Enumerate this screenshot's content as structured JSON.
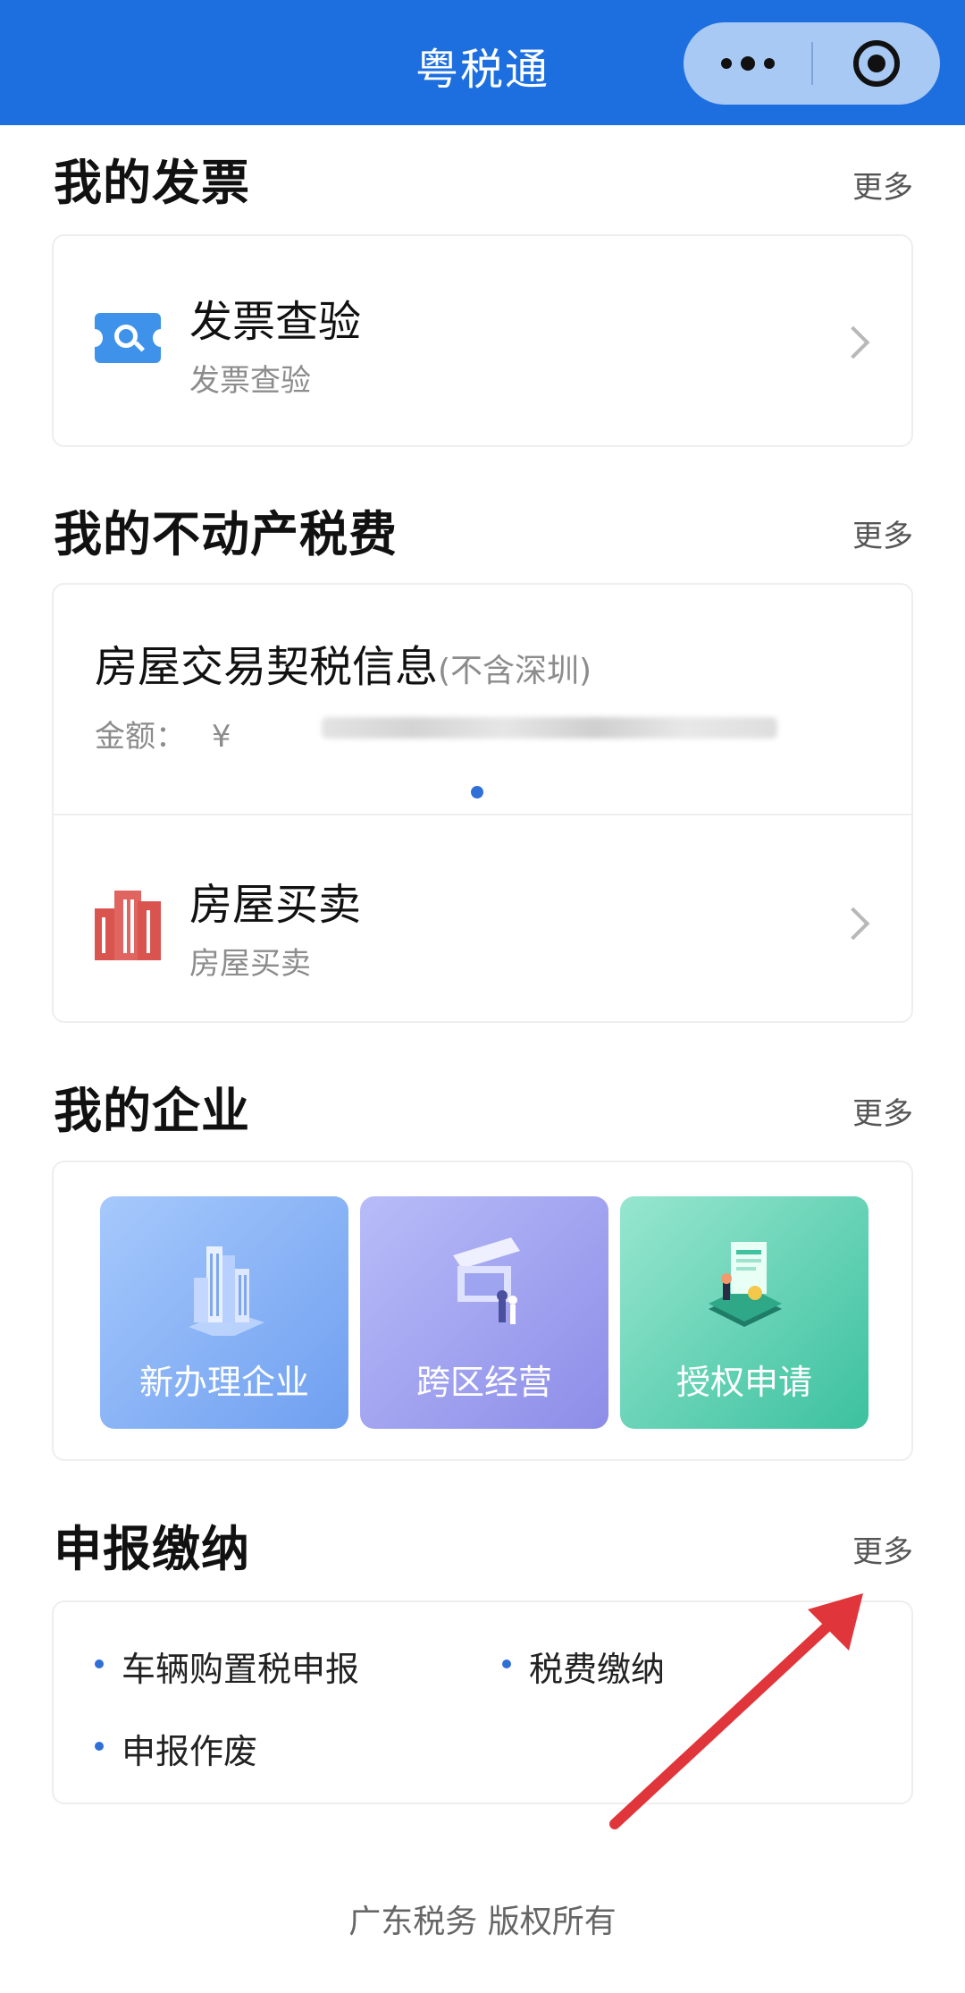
{
  "header": {
    "title": "粤税通"
  },
  "invoice": {
    "title": "我的发票",
    "more": "更多",
    "item": {
      "title": "发票查验",
      "subtitle": "发票查验"
    }
  },
  "realestate": {
    "title": "我的不动产税费",
    "more": "更多",
    "deed": {
      "title": "房屋交易契税信息",
      "note": "(不含深圳)",
      "amount_label": "金额：",
      "currency": "¥"
    },
    "item": {
      "title": "房屋买卖",
      "subtitle": "房屋买卖"
    }
  },
  "enterprise": {
    "title": "我的企业",
    "more": "更多",
    "tiles": [
      {
        "label": "新办理企业",
        "color_from": "#9cc3fb",
        "color_to": "#6ea2f2"
      },
      {
        "label": "跨区经营",
        "color_from": "#b4b8f6",
        "color_to": "#8e8fea"
      },
      {
        "label": "授权申请",
        "color_from": "#8de3c9",
        "color_to": "#3ec2a0"
      }
    ]
  },
  "declare": {
    "title": "申报缴纳",
    "more": "更多",
    "items": [
      "车辆购置税申报",
      "税费缴纳",
      "申报作废"
    ]
  },
  "footer": {
    "text": "广东税务 版权所有"
  },
  "colors": {
    "brand": "#1d6fe0",
    "annotation_arrow": "#e0353a"
  }
}
